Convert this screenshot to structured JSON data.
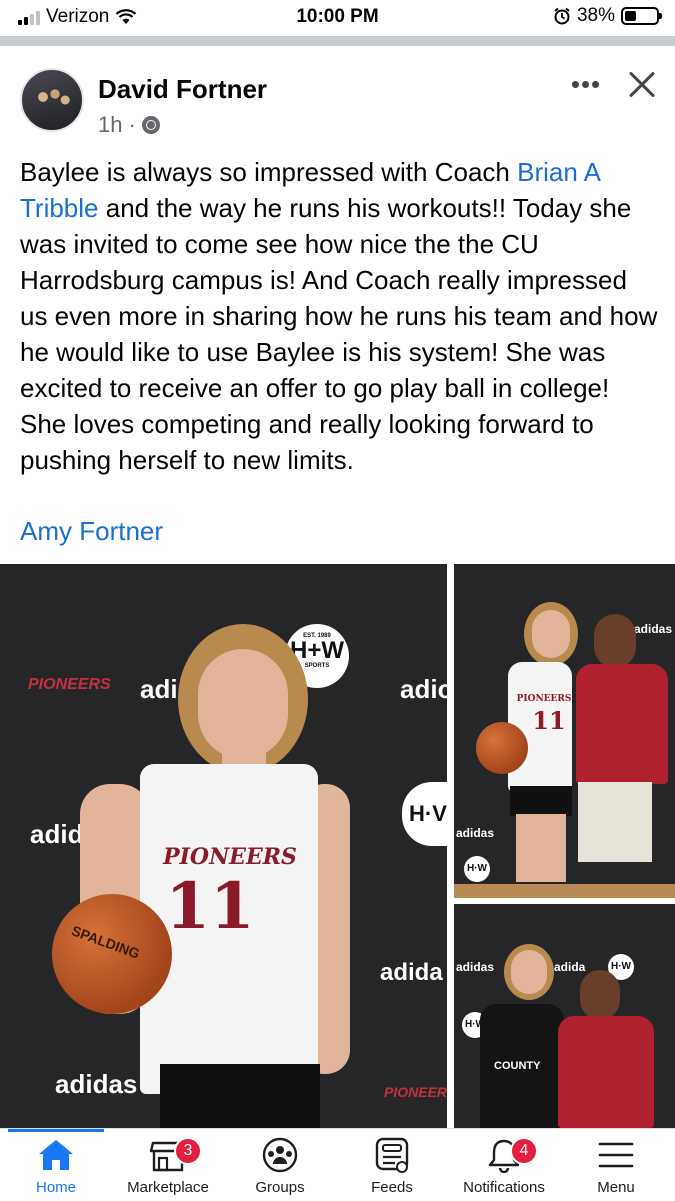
{
  "status_bar": {
    "carrier": "Verizon",
    "time": "10:00 PM",
    "battery": "38%",
    "battery_level": 0.38,
    "signal_bars": 2
  },
  "post": {
    "author": "David Fortner",
    "time": "1h",
    "privacy_icon": "globe-icon",
    "body_prefix": "Baylee is always so impressed with Coach ",
    "mention": "Brian A Tribble",
    "body_suffix": " and the way he runs his workouts!! Today she was invited to come see how nice the the CU Harrodsburg campus is! And Coach really impressed us even more in sharing how he runs his team and how he would like to use Baylee is his system! She was excited to receive an offer to go play ball in college! She loves competing and really looking forward to pushing herself to new limits.",
    "tagged": "Amy Fortner"
  },
  "photos": {
    "main": {
      "backdrop": [
        "adidas",
        "PIONEERS",
        "H+W",
        "SPORTS",
        "EST. 1989"
      ],
      "jersey_text": "PIONEERS",
      "jersey_number": "11",
      "ball_text": "SPALDING"
    },
    "top_right": {
      "jersey_text": "PIONEERS",
      "jersey_number": "11"
    },
    "bottom_right": {
      "shirt_text": "COUNTY"
    }
  },
  "nav": {
    "items": [
      {
        "label": "Home",
        "icon": "home-icon",
        "active": true
      },
      {
        "label": "Marketplace",
        "icon": "marketplace-icon",
        "badge": "3"
      },
      {
        "label": "Groups",
        "icon": "groups-icon"
      },
      {
        "label": "Feeds",
        "icon": "feeds-icon"
      },
      {
        "label": "Notifications",
        "icon": "bell-icon",
        "badge": "4"
      },
      {
        "label": "Menu",
        "icon": "menu-icon"
      }
    ]
  },
  "colors": {
    "link": "#1a6fd6",
    "accent": "#1877f2",
    "badge": "#e41e3f"
  }
}
